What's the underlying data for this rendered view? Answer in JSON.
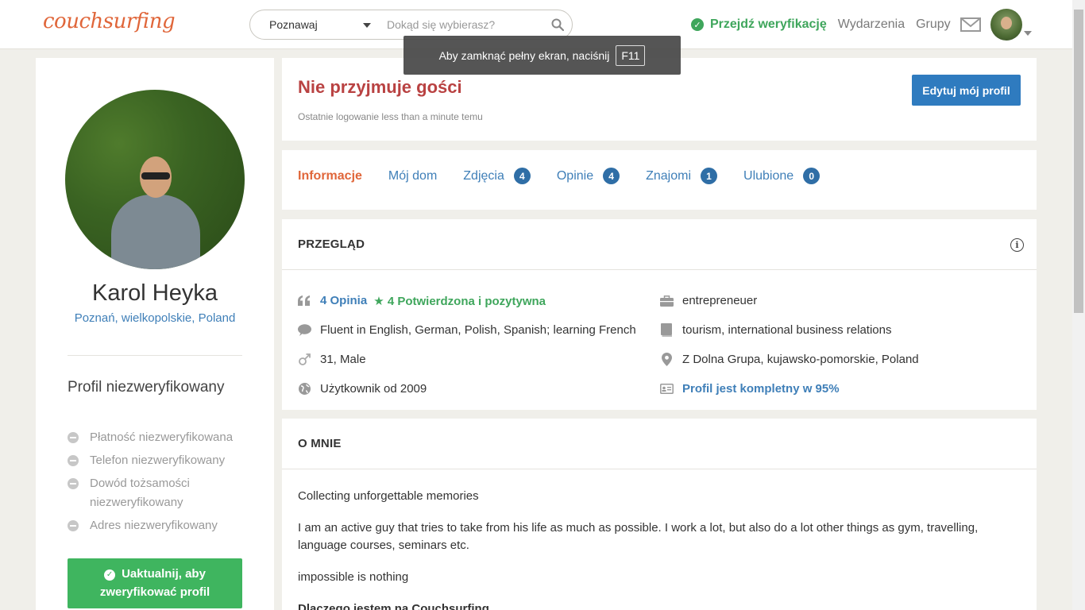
{
  "header": {
    "logo": "couchsurfing",
    "search_mode": "Poznawaj",
    "search_placeholder": "Dokąd się wybierasz?",
    "verify_link": "Przejdź weryfikację",
    "nav_events": "Wydarzenia",
    "nav_groups": "Grupy"
  },
  "fullscreen_tip": {
    "text": "Aby zamknąć pełny ekran, naciśnij",
    "key": "F11"
  },
  "profile": {
    "name": "Karol Heyka",
    "location": "Poznań, wielkopolskie, Poland",
    "verification_title": "Profil niezweryfikowany",
    "verifications": [
      "Płatność niezweryfikowana",
      "Telefon niezweryfikowany",
      "Dowód tożsamości niezweryfikowany",
      "Adres niezweryfikowany"
    ],
    "upgrade_button": "Uaktualnij, aby zweryfikować profil"
  },
  "status": {
    "title": "Nie przyjmuje gości",
    "last_login": "Ostatnie logowanie less than a minute temu",
    "edit_button": "Edytuj mój profil"
  },
  "tabs": [
    {
      "label": "Informacje",
      "count": ""
    },
    {
      "label": "Mój dom",
      "count": ""
    },
    {
      "label": "Zdjęcia",
      "count": "4"
    },
    {
      "label": "Opinie",
      "count": "4"
    },
    {
      "label": "Znajomi",
      "count": "1"
    },
    {
      "label": "Ulubione",
      "count": "0"
    }
  ],
  "overview": {
    "title": "PRZEGLĄD",
    "references": "4 Opinia",
    "confirmed": "4 Potwierdzona i pozytywna",
    "languages": "Fluent in English, German, Polish, Spanish; learning French",
    "age_gender": "31, Male",
    "member_since": "Użytkownik od 2009",
    "occupation": "entrepreneuer",
    "education": "tourism, international business relations",
    "hometown": "Z Dolna Grupa, kujawsko-pomorskie, Poland",
    "completeness": "Profil jest kompletny w 95%"
  },
  "about": {
    "title": "O MNIE",
    "line1": "Collecting unforgettable memories",
    "line2": "I am an active guy that tries to take from his life as much as possible. I work a lot, but also do a lot other things as gym, travelling, language courses, seminars etc.",
    "line3": "impossible is nothing",
    "line4": "Dlaczego jestem na Couchsurfing"
  },
  "colors": {
    "brand_orange": "#e0663a",
    "link_blue": "#3f7fb8",
    "verify_green": "#3fa65c",
    "status_red": "#b94242",
    "badge_blue": "#2f6ea6"
  }
}
